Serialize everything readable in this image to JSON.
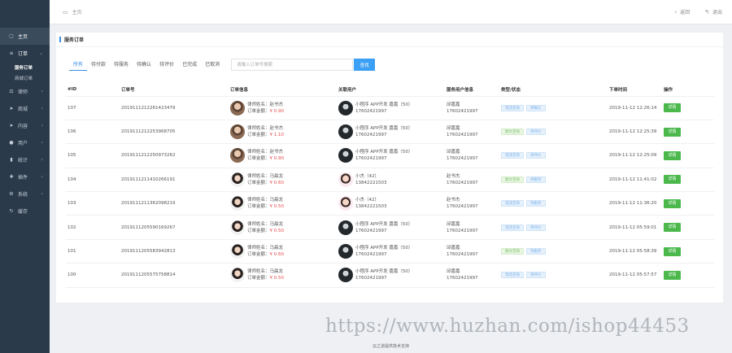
{
  "sidebar": {
    "items": [
      {
        "label": "主页",
        "icon": "file-icon",
        "chev": ""
      },
      {
        "label": "订单",
        "icon": "list-icon",
        "chev": "⌄",
        "open": true
      },
      {
        "label": "律师",
        "icon": "gavel-icon",
        "chev": "‹"
      },
      {
        "label": "商城",
        "icon": "send-icon",
        "chev": "‹"
      },
      {
        "label": "内容",
        "icon": "send-icon",
        "chev": "‹"
      },
      {
        "label": "用户",
        "icon": "user-icon",
        "chev": "‹"
      },
      {
        "label": "统计",
        "icon": "stats-icon",
        "chev": "‹"
      },
      {
        "label": "插件",
        "icon": "plugin-icon",
        "chev": "‹"
      },
      {
        "label": "系统",
        "icon": "gear-icon",
        "chev": "‹"
      },
      {
        "label": "缓存",
        "icon": "refresh-icon",
        "chev": ""
      }
    ],
    "sub_items": [
      "服务订单",
      "商城订单"
    ]
  },
  "topbar": {
    "breadcrumb": "主页",
    "back_label": "返回",
    "logout_label": "退出"
  },
  "card": {
    "title": "服务订单"
  },
  "filters": {
    "tabs": [
      "所有",
      "待付款",
      "待服务",
      "待确认",
      "待评价",
      "已完成",
      "已取消"
    ],
    "active_tab": "所有",
    "search_placeholder": "请输入订单号搜索",
    "search_button": "查找"
  },
  "table": {
    "headers": [
      "#ID",
      "订单号",
      "订单信息",
      "关联用户",
      "服务用户信息",
      "类型/状态",
      "下单时间",
      "操作"
    ],
    "rows": [
      {
        "id": "107",
        "order_no": "2019111212261423479",
        "info_line1": "律师姓名：赵书杰",
        "info_line2_label": "订单金额：",
        "amount": "¥ 0.90",
        "lawyer_avatar": "lawyer1",
        "user_line1": "小程序 APP开发 嘉嘉（50）",
        "user_line2": "17602421997",
        "user_avatar": "user1",
        "svc_name": "邱嘉嘉",
        "svc_phone": "17602421997",
        "type_tag": "电话咨询",
        "type_color": "blue",
        "status_tag": "待确认",
        "status_color": "blue",
        "time": "2019-11-12 12:26:14",
        "action": "详情"
      },
      {
        "id": "106",
        "order_no": "2019111212253968705",
        "info_line1": "律师姓名：赵书杰",
        "info_line2_label": "订单金额：",
        "amount": "¥ 1.10",
        "lawyer_avatar": "lawyer1",
        "user_line1": "小程序 APP开发 嘉嘉（50）",
        "user_line2": "17602421997",
        "user_avatar": "user1",
        "svc_name": "邱嘉嘉",
        "svc_phone": "17602421997",
        "type_tag": "图文咨询",
        "type_color": "green",
        "status_tag": "待评价",
        "status_color": "blue",
        "time": "2019-11-12 12:25:39",
        "action": "详情"
      },
      {
        "id": "105",
        "order_no": "2019111212250973262",
        "info_line1": "律师姓名：赵书杰",
        "info_line2_label": "订单金额：",
        "amount": "¥ 0.90",
        "lawyer_avatar": "lawyer1",
        "user_line1": "小程序 APP开发 嘉嘉（50）",
        "user_line2": "17602421997",
        "user_avatar": "user1",
        "svc_name": "邱嘉嘉",
        "svc_phone": "17602421997",
        "type_tag": "电话咨询",
        "type_color": "blue",
        "status_tag": "待评价",
        "status_color": "blue",
        "time": "2019-11-12 12:25:09",
        "action": "详情"
      },
      {
        "id": "104",
        "order_no": "2019111211410266191",
        "info_line1": "律师姓名：马晨龙",
        "info_line2_label": "订单金额：",
        "amount": "¥ 0.60",
        "lawyer_avatar": "lawyer2",
        "user_line1": "小杰（42）",
        "user_line2": "13842221503",
        "user_avatar": "user2",
        "svc_name": "赵书杰",
        "svc_phone": "17602421997",
        "type_tag": "图文咨询",
        "type_color": "green",
        "status_tag": "待服务",
        "status_color": "blue",
        "time": "2019-11-12 11:41:02",
        "action": "详情"
      },
      {
        "id": "103",
        "order_no": "2019111211362098219",
        "info_line1": "律师姓名：马晨龙",
        "info_line2_label": "订单金额：",
        "amount": "¥ 0.50",
        "lawyer_avatar": "lawyer2",
        "user_line1": "小杰（42）",
        "user_line2": "13842221503",
        "user_avatar": "user2",
        "svc_name": "赵书杰",
        "svc_phone": "17602421997",
        "type_tag": "电话咨询",
        "type_color": "blue",
        "status_tag": "待服务",
        "status_color": "blue",
        "time": "2019-11-12 11:36:20",
        "action": "详情"
      },
      {
        "id": "102",
        "order_no": "2019111205590169267",
        "info_line1": "律师姓名：马晨龙",
        "info_line2_label": "订单金额：",
        "amount": "¥ 0.50",
        "lawyer_avatar": "lawyer2",
        "user_line1": "小程序 APP开发 嘉嘉（50）",
        "user_line2": "17602421997",
        "user_avatar": "user1",
        "svc_name": "邱嘉嘉",
        "svc_phone": "17602421997",
        "type_tag": "电话咨询",
        "type_color": "blue",
        "status_tag": "待评价",
        "status_color": "blue",
        "time": "2019-11-12 05:59:01",
        "action": "详情"
      },
      {
        "id": "101",
        "order_no": "2019111205583942813",
        "info_line1": "律师姓名：马晨龙",
        "info_line2_label": "订单金额：",
        "amount": "¥ 0.60",
        "lawyer_avatar": "lawyer2",
        "user_line1": "小程序 APP开发 嘉嘉（50）",
        "user_line2": "17602421997",
        "user_avatar": "user1",
        "svc_name": "邱嘉嘉",
        "svc_phone": "17602421997",
        "type_tag": "图文咨询",
        "type_color": "green",
        "status_tag": "待服务",
        "status_color": "blue",
        "time": "2019-11-12 05:58:39",
        "action": "详情"
      },
      {
        "id": "100",
        "order_no": "2019111205575758814",
        "info_line1": "律师姓名：马晨龙",
        "info_line2_label": "订单金额：",
        "amount": "¥ 0.50",
        "lawyer_avatar": "lawyer2",
        "user_line1": "小程序 APP开发 嘉嘉（50）",
        "user_line2": "17602421997",
        "user_avatar": "user1",
        "svc_name": "邱嘉嘉",
        "svc_phone": "17602421997",
        "type_tag": "电话咨询",
        "type_color": "blue",
        "status_tag": "待评价",
        "status_color": "blue",
        "time": "2019-11-12 05:57:57",
        "action": "详情"
      }
    ]
  },
  "footer": {
    "text": "云之道提供技术支持"
  },
  "watermark": {
    "text": "https://www.huzhan.com/ishop44453"
  },
  "colors": {
    "sidebar_bg": "#2b3a4a",
    "accent": "#3a8ee6",
    "search_button": "#3a9ff5",
    "detail_button": "#4cb84c",
    "amount_red": "#e84a4a"
  }
}
